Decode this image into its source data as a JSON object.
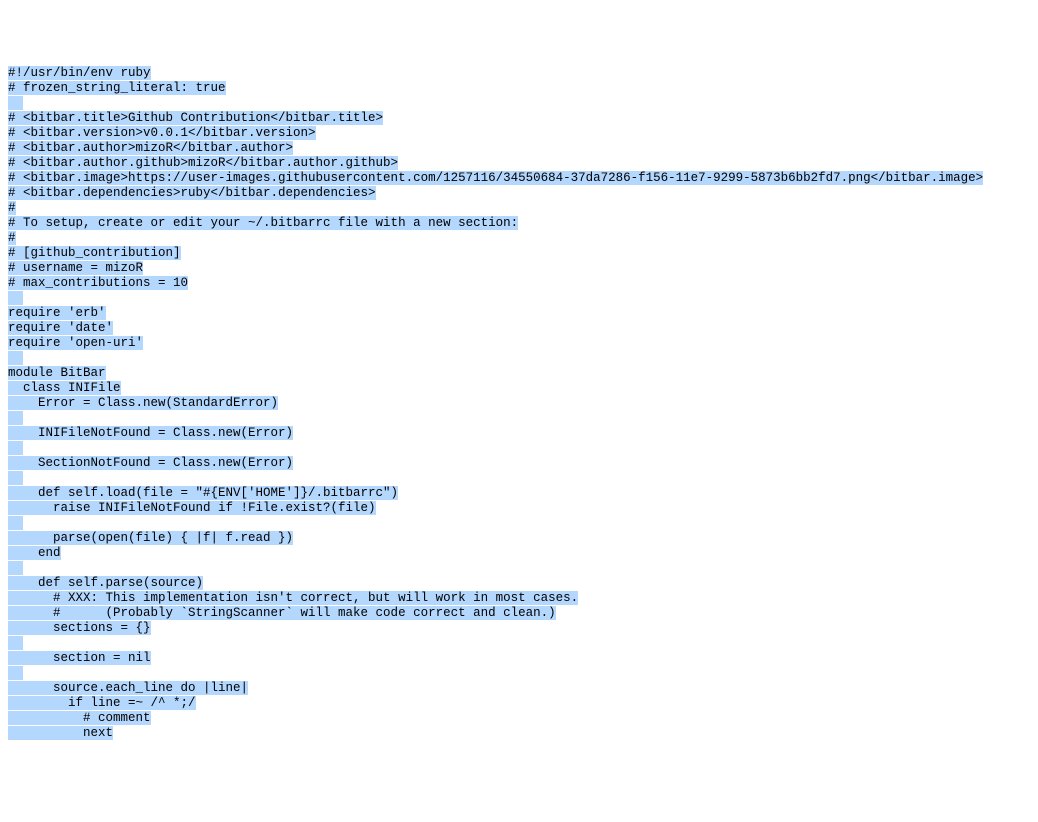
{
  "code": {
    "lines": [
      "#!/usr/bin/env ruby",
      "# frozen_string_literal: true",
      "",
      "# <bitbar.title>Github Contribution</bitbar.title>",
      "# <bitbar.version>v0.0.1</bitbar.version>",
      "# <bitbar.author>mizoR</bitbar.author>",
      "# <bitbar.author.github>mizoR</bitbar.author.github>",
      "# <bitbar.image>https://user-images.githubusercontent.com/1257116/34550684-37da7286-f156-11e7-9299-5873b6bb2fd7.png</bitbar.image>",
      "# <bitbar.dependencies>ruby</bitbar.dependencies>",
      "#",
      "# To setup, create or edit your ~/.bitbarrc file with a new section:",
      "#",
      "# [github_contribution]",
      "# username = mizoR",
      "# max_contributions = 10",
      "",
      "require 'erb'",
      "require 'date'",
      "require 'open-uri'",
      "",
      "module BitBar",
      "  class INIFile",
      "    Error = Class.new(StandardError)",
      "",
      "    INIFileNotFound = Class.new(Error)",
      "",
      "    SectionNotFound = Class.new(Error)",
      "",
      "    def self.load(file = \"#{ENV['HOME']}/.bitbarrc\")",
      "      raise INIFileNotFound if !File.exist?(file)",
      "",
      "      parse(open(file) { |f| f.read })",
      "    end",
      "",
      "    def self.parse(source)",
      "      # XXX: This implementation isn't correct, but will work in most cases.",
      "      #      (Probably `StringScanner` will make code correct and clean.)",
      "      sections = {}",
      "",
      "      section = nil",
      "",
      "      source.each_line do |line|",
      "        if line =~ /^ *;/",
      "          # comment",
      "          next"
    ]
  }
}
